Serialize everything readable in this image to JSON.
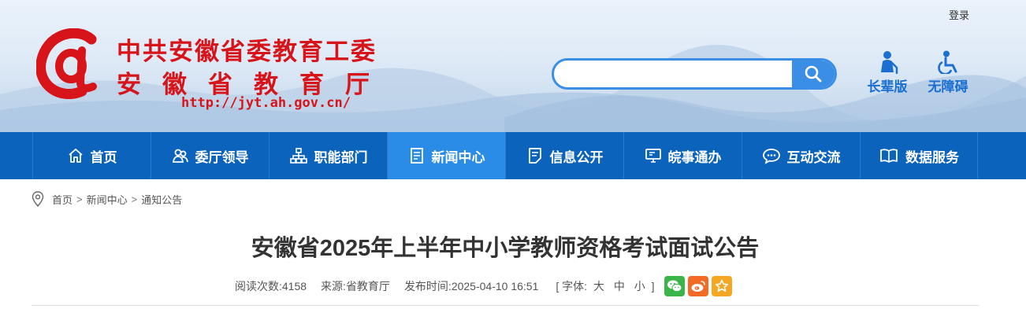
{
  "header": {
    "login": "登录",
    "org_line1": "中共安徽省委教育工委",
    "org_line2": "安徽省教育厅",
    "url": "http://jyt.ah.gov.cn/",
    "search": {
      "value": "",
      "placeholder": ""
    },
    "tools": [
      {
        "label": "长辈版",
        "icon": "elder-icon"
      },
      {
        "label": "无障碍",
        "icon": "accessibility-icon"
      }
    ]
  },
  "nav": {
    "items": [
      {
        "label": "首页",
        "icon": "home-icon"
      },
      {
        "label": "委厅领导",
        "icon": "leaders-icon"
      },
      {
        "label": "职能部门",
        "icon": "org-chart-icon"
      },
      {
        "label": "新闻中心",
        "icon": "news-icon",
        "active": true
      },
      {
        "label": "信息公开",
        "icon": "info-icon"
      },
      {
        "label": "皖事通办",
        "icon": "monitor-icon"
      },
      {
        "label": "互动交流",
        "icon": "chat-icon"
      },
      {
        "label": "数据服务",
        "icon": "book-icon"
      }
    ]
  },
  "breadcrumb": {
    "items": [
      "首页",
      "新闻中心",
      "通知公告"
    ],
    "separator": ">"
  },
  "article": {
    "title": "安徽省2025年上半年中小学教师资格考试面试公告",
    "meta": {
      "views_label": "阅读次数:",
      "views": "4158",
      "source_label": "来源:",
      "source": "省教育厅",
      "time_label": "发布时间:",
      "time": "2025-04-10 16:51",
      "font_open": "[ 字体:",
      "font_large": "大",
      "font_medium": "中",
      "font_small": "小",
      "font_close": "]"
    },
    "share": [
      {
        "icon": "wechat-icon",
        "color": "#3bb449"
      },
      {
        "icon": "weibo-icon",
        "color": "#f26a26"
      },
      {
        "icon": "favorite-icon",
        "color": "#f5a623"
      }
    ]
  },
  "colors": {
    "brand_red": "#d7141a",
    "nav_blue": "#0c63bc",
    "nav_active": "#2b8ce8",
    "accent": "#3a8ee6"
  }
}
